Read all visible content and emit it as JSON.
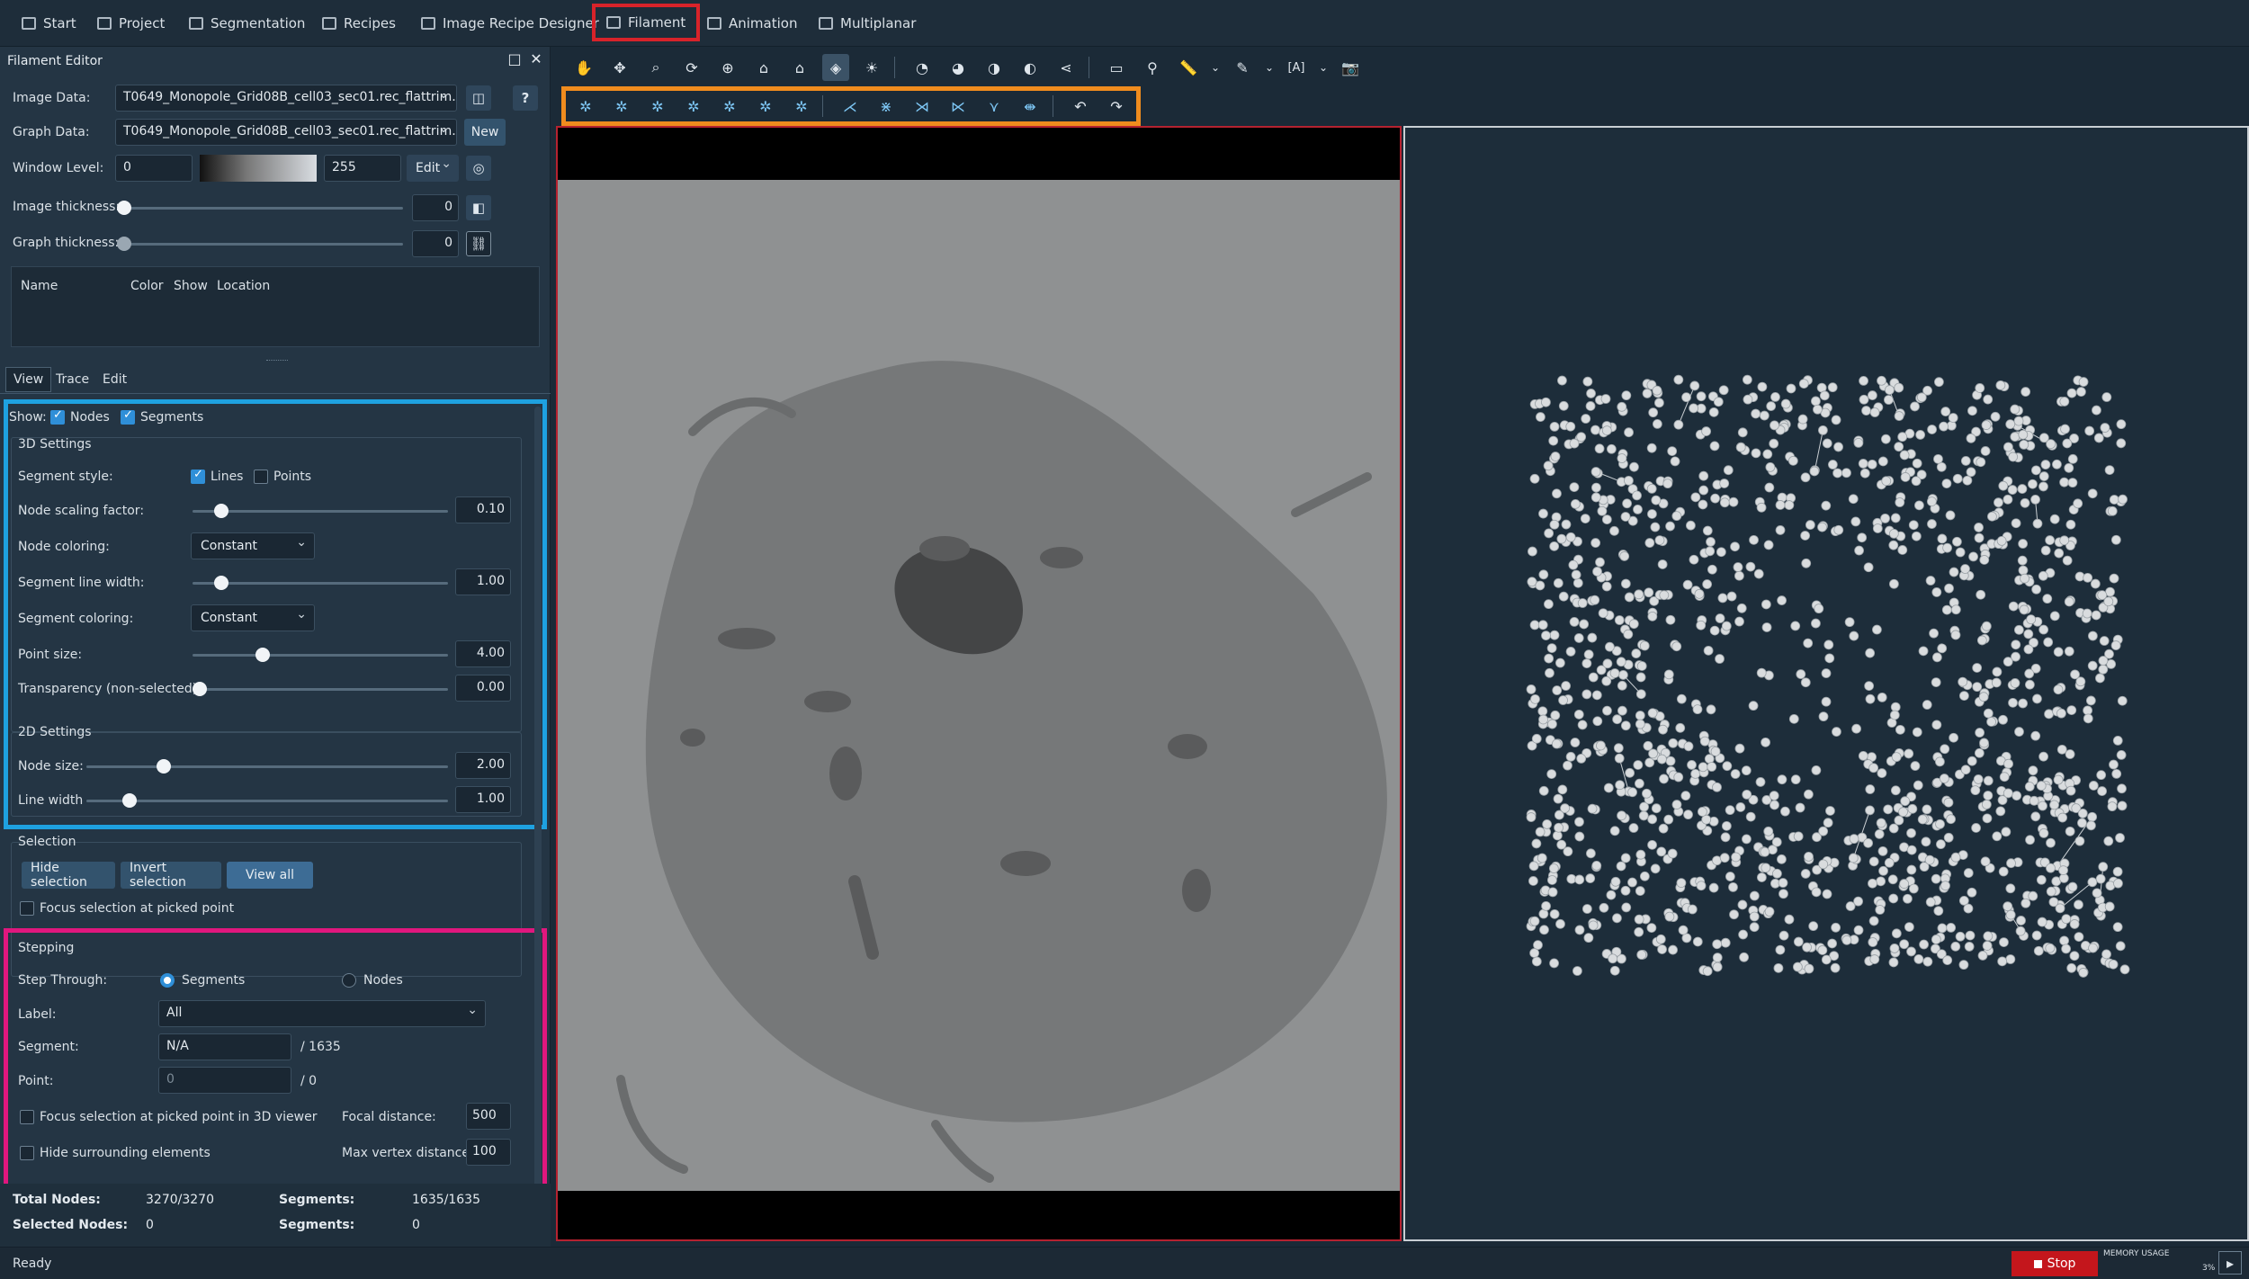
{
  "menubar": {
    "items": [
      "Start",
      "Project",
      "Segmentation",
      "Recipes",
      "Image Recipe Designer",
      "Filament",
      "Animation",
      "Multiplanar"
    ],
    "active": "Filament"
  },
  "editor": {
    "title": "Filament Editor",
    "image_data_label": "Image Data:",
    "image_data_value": "T0649_Monopole_Grid08B_cell03_sec01.rec_flattrim.rec",
    "graph_data_label": "Graph Data:",
    "graph_data_value": "T0649_Monopole_Grid08B_cell03_sec01.rec_flattrim.rec",
    "new_button": "New",
    "window_level_label": "Window Level:",
    "window_level_min": "0",
    "window_level_max": "255",
    "edit_button": "Edit",
    "image_thickness_label": "Image thickness:",
    "image_thickness_value": "0",
    "graph_thickness_label": "Graph thickness:",
    "graph_thickness_value": "0",
    "table_headers": [
      "Name",
      "Color",
      "Show",
      "Location"
    ],
    "help": "?"
  },
  "tabs": [
    "View",
    "Trace",
    "Edit"
  ],
  "view": {
    "show_label": "Show:",
    "show_nodes": "Nodes",
    "show_segments": "Segments",
    "settings3d_title": "3D Settings",
    "segment_style_label": "Segment style:",
    "segment_style_lines": "Lines",
    "segment_style_points": "Points",
    "node_scaling_label": "Node scaling factor:",
    "node_scaling_value": "0.10",
    "node_scaling_level": 0.1,
    "node_coloring_label": "Node coloring:",
    "node_coloring_value": "Constant",
    "segment_line_width_label": "Segment line width:",
    "segment_line_width_value": "1.00",
    "segment_coloring_label": "Segment coloring:",
    "segment_coloring_value": "Constant",
    "point_size_label": "Point size:",
    "point_size_value": "4.00",
    "transparency_label": "Transparency (non-selected):",
    "transparency_value": "0.00",
    "settings2d_title": "2D Settings",
    "node_size_label": "Node size:",
    "node_size_value": "2.00",
    "line_width_label": "Line width",
    "line_width_value": "1.00"
  },
  "selection": {
    "title": "Selection",
    "hide_button": "Hide selection",
    "invert_button": "Invert selection",
    "view_all_button": "View all",
    "focus_label": "Focus selection at picked point"
  },
  "stepping": {
    "title": "Stepping",
    "step_through_label": "Step Through:",
    "segments_option": "Segments",
    "nodes_option": "Nodes",
    "label_label": "Label:",
    "label_value": "All",
    "segment_label": "Segment:",
    "segment_value": "N/A",
    "segment_total": "/ 1635",
    "point_label": "Point:",
    "point_value": "0",
    "point_total": "/ 0",
    "focus3d_label": "Focus selection at picked point in 3D viewer",
    "focal_distance_label": "Focal distance:",
    "focal_distance_value": "500",
    "hide_surrounding_label": "Hide surrounding elements",
    "max_vertex_label": "Max vertex distance:",
    "max_vertex_value": "100"
  },
  "stats": {
    "total_nodes_label": "Total Nodes:",
    "total_nodes_value": "3270/3270",
    "segments_label": "Segments:",
    "segments_value": "1635/1635",
    "selected_nodes_label": "Selected Nodes:",
    "selected_nodes_value": "0",
    "selected_segments_label": "Segments:",
    "selected_segments_value": "0"
  },
  "status": {
    "ready": "Ready",
    "stop_button": "Stop",
    "memory_label": "MEMORY USAGE",
    "memory_value": "3%"
  },
  "colors": {
    "highlight_menu": "#d8232a",
    "highlight_view": "#1ea1e0",
    "highlight_stepping": "#e0177e",
    "highlight_toolbar": "#f08c1e",
    "accent": "#2f8fd8"
  }
}
